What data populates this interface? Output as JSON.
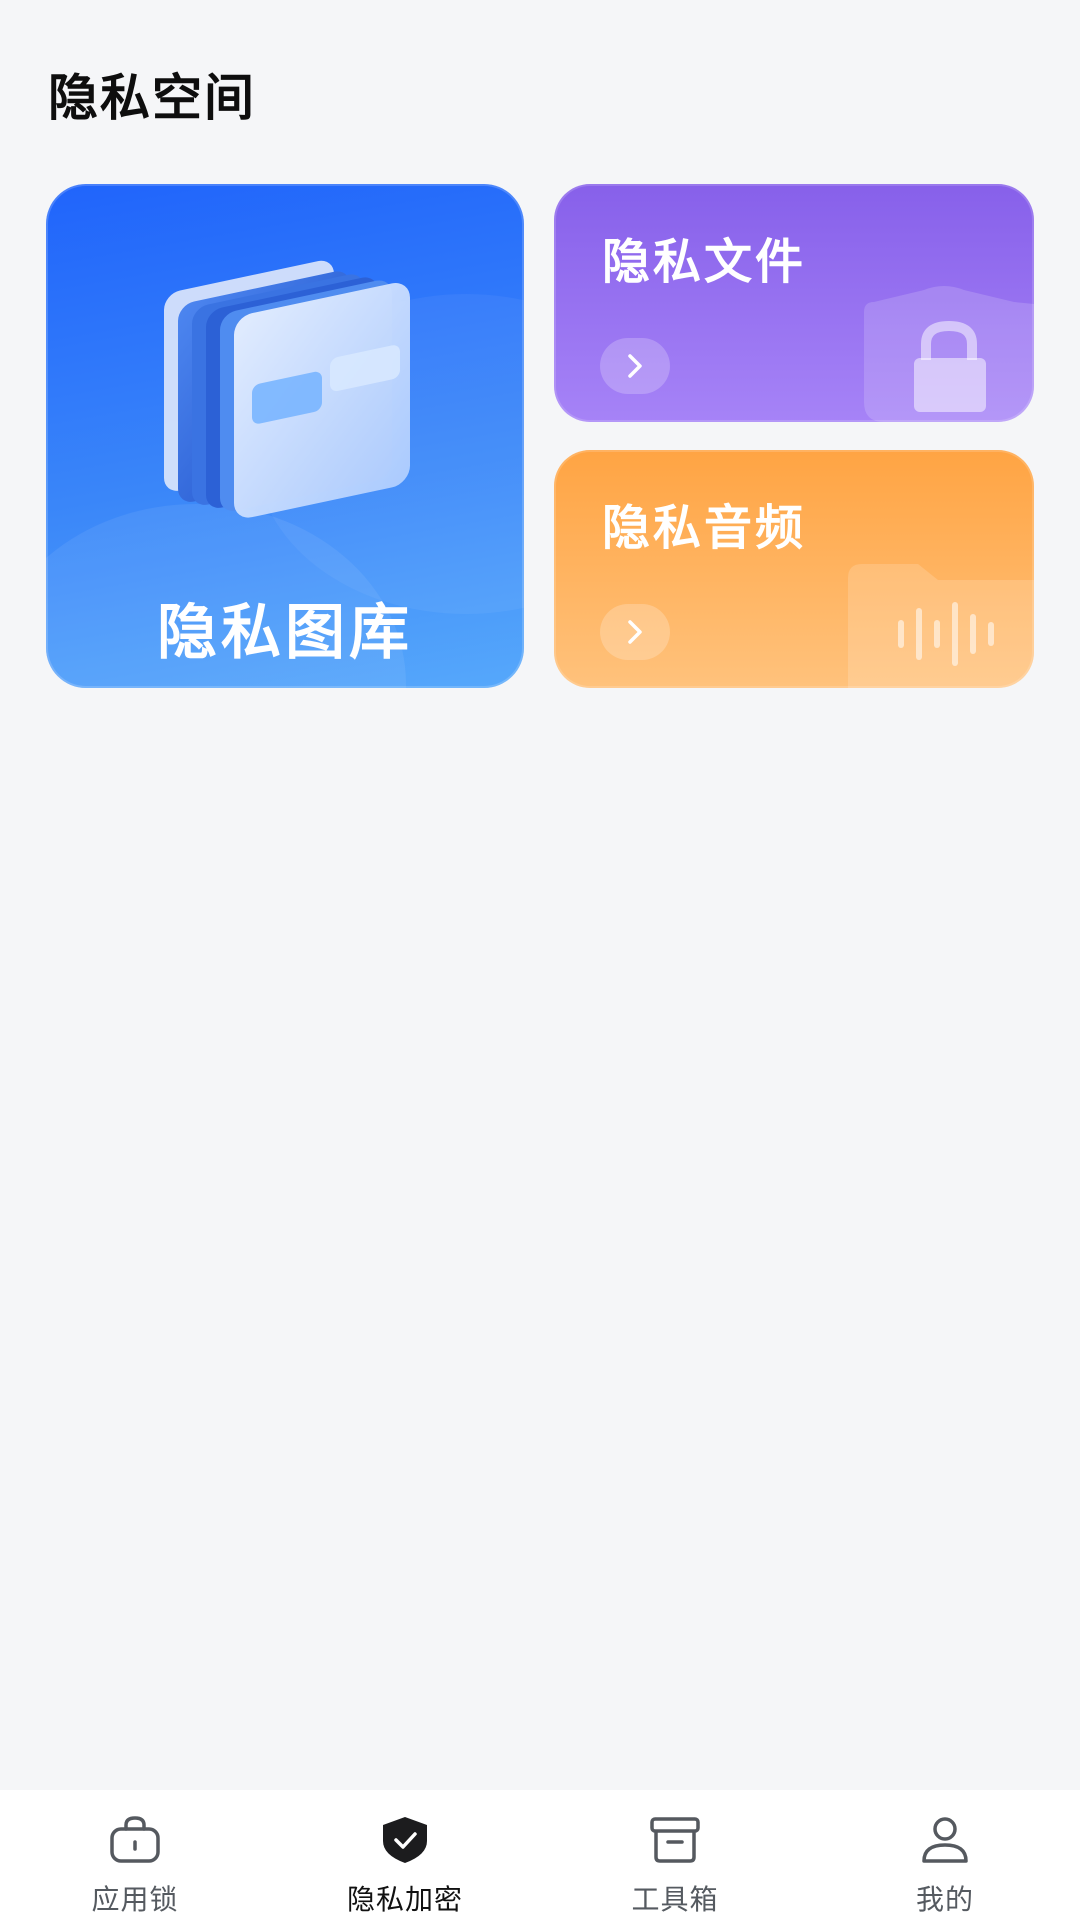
{
  "page": {
    "title": "隐私空间"
  },
  "cards": {
    "gallery": {
      "label": "隐私图库"
    },
    "files": {
      "label": "隐私文件"
    },
    "audio": {
      "label": "隐私音频"
    }
  },
  "bottom_nav": {
    "items": [
      {
        "label": "应用锁",
        "icon": "lock-bag-icon",
        "active": false
      },
      {
        "label": "隐私加密",
        "icon": "shield-check-icon",
        "active": true
      },
      {
        "label": "工具箱",
        "icon": "archive-box-icon",
        "active": false
      },
      {
        "label": "我的",
        "icon": "person-icon",
        "active": false
      }
    ]
  },
  "colors": {
    "gallery_card": "#2064fb",
    "files_card": "#8760ea",
    "audio_card": "#ffa443",
    "nav_active": "#111111",
    "nav_inactive": "#555a60"
  }
}
